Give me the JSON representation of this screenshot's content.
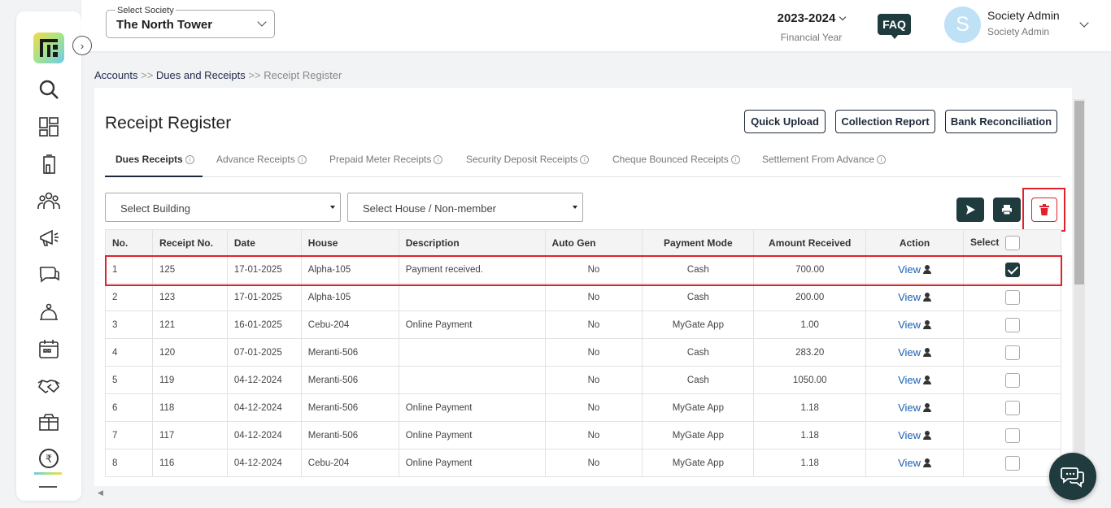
{
  "header": {
    "society_label": "Select Society",
    "society_value": "The North Tower",
    "financial_year": "2023-2024",
    "financial_year_label": "Financial Year",
    "faq": "FAQ",
    "avatar_letter": "S",
    "user_name": "Society Admin",
    "user_role": "Society Admin"
  },
  "breadcrumb": {
    "items": [
      "Accounts",
      "Dues and Receipts",
      "Receipt Register"
    ],
    "separator": ">>"
  },
  "page": {
    "title": "Receipt Register",
    "buttons": {
      "quick_upload": "Quick Upload",
      "collection_report": "Collection Report",
      "bank_reconciliation": "Bank Reconciliation"
    }
  },
  "tabs": [
    {
      "label": "Dues Receipts",
      "active": true
    },
    {
      "label": "Advance Receipts",
      "active": false
    },
    {
      "label": "Prepaid Meter Receipts",
      "active": false
    },
    {
      "label": "Security Deposit Receipts",
      "active": false
    },
    {
      "label": "Cheque Bounced Receipts",
      "active": false
    },
    {
      "label": "Settlement From Advance",
      "active": false
    }
  ],
  "filters": {
    "building_placeholder": "Select Building",
    "house_placeholder": "Select House / Non-member"
  },
  "table": {
    "columns": [
      "No.",
      "Receipt No.",
      "Date",
      "House",
      "Description",
      "Auto Gen",
      "Payment Mode",
      "Amount Received",
      "Action",
      "Select"
    ],
    "view_label": "View",
    "rows": [
      {
        "no": "1",
        "receipt": "125",
        "date": "17-01-2025",
        "house": "Alpha-105",
        "desc": "Payment received.",
        "auto": "No",
        "mode": "Cash",
        "amount": "700.00",
        "selected": true
      },
      {
        "no": "2",
        "receipt": "123",
        "date": "17-01-2025",
        "house": "Alpha-105",
        "desc": "",
        "auto": "No",
        "mode": "Cash",
        "amount": "200.00",
        "selected": false
      },
      {
        "no": "3",
        "receipt": "121",
        "date": "16-01-2025",
        "house": "Cebu-204",
        "desc": "Online Payment",
        "auto": "No",
        "mode": "MyGate App",
        "amount": "1.00",
        "selected": false
      },
      {
        "no": "4",
        "receipt": "120",
        "date": "07-01-2025",
        "house": "Meranti-506",
        "desc": "",
        "auto": "No",
        "mode": "Cash",
        "amount": "283.20",
        "selected": false
      },
      {
        "no": "5",
        "receipt": "119",
        "date": "04-12-2024",
        "house": "Meranti-506",
        "desc": "",
        "auto": "No",
        "mode": "Cash",
        "amount": "1050.00",
        "selected": false
      },
      {
        "no": "6",
        "receipt": "118",
        "date": "04-12-2024",
        "house": "Meranti-506",
        "desc": "Online Payment",
        "auto": "No",
        "mode": "MyGate App",
        "amount": "1.18",
        "selected": false
      },
      {
        "no": "7",
        "receipt": "117",
        "date": "04-12-2024",
        "house": "Meranti-506",
        "desc": "Online Payment",
        "auto": "No",
        "mode": "MyGate App",
        "amount": "1.18",
        "selected": false
      },
      {
        "no": "8",
        "receipt": "116",
        "date": "04-12-2024",
        "house": "Cebu-204",
        "desc": "Online Payment",
        "auto": "No",
        "mode": "MyGate App",
        "amount": "1.18",
        "selected": false
      }
    ]
  },
  "colors": {
    "primary_dark": "#1f3b3d",
    "highlight_red": "#e0232a",
    "link_blue": "#1a5fb4"
  },
  "icons": {
    "sidebar": [
      "search-icon",
      "dashboard-icon",
      "building-icon",
      "members-icon",
      "announcement-icon",
      "chat-icon",
      "helpdesk-icon",
      "calendar-icon",
      "handshake-icon",
      "amenities-icon",
      "rupee-icon"
    ],
    "actions": [
      "send-icon",
      "print-icon",
      "trash-icon"
    ],
    "fab": "chat-support-icon"
  }
}
